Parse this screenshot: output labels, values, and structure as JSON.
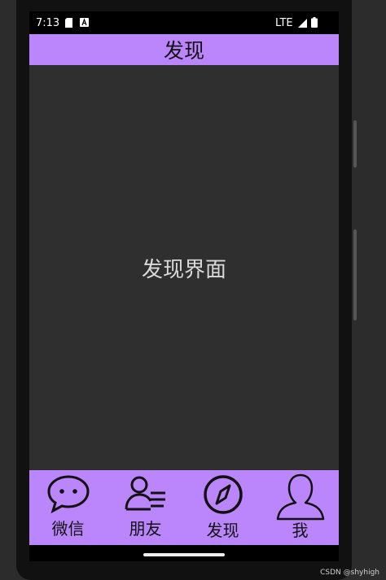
{
  "status_bar": {
    "time": "7:13",
    "network": "LTE"
  },
  "app_bar": {
    "title": "发现"
  },
  "content": {
    "text": "发现界面"
  },
  "bottom_nav": {
    "items": [
      {
        "label": "微信",
        "icon": "chat-bubble-icon"
      },
      {
        "label": "朋友",
        "icon": "contacts-icon"
      },
      {
        "label": "发现",
        "icon": "compass-icon"
      },
      {
        "label": "我",
        "icon": "person-icon"
      }
    ]
  },
  "watermark": "CSDN @shyhigh",
  "colors": {
    "accent": "#bb86fc",
    "content_bg": "#2f2f2f"
  }
}
